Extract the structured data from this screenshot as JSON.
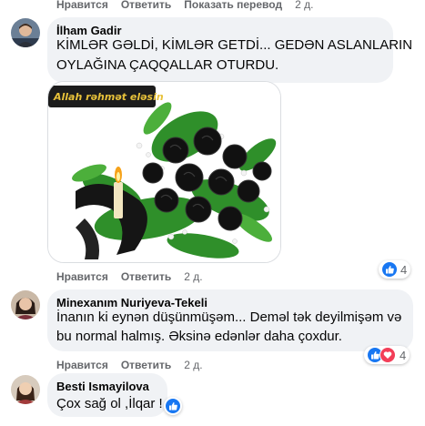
{
  "top_actions": {
    "like": "Нравится",
    "reply": "Ответить",
    "translate": "Показать перевод",
    "time": "2 д."
  },
  "comments": [
    {
      "author": "İlham Gadir",
      "lines": [
        "KİMLƏR GƏLDİ, KİMLƏR GETDİ... GEDƏN ASLANLARIN",
        "OYLAĞINA ÇAQQALLAR OTURDU."
      ],
      "image_caption": "Allah rəhmət eləsin",
      "actions": {
        "like": "Нравится",
        "reply": "Ответить",
        "time": "2 д."
      },
      "reactions": {
        "count": "4"
      }
    },
    {
      "author": "Minexanım Nuriyeva-Tekeli",
      "lines": [
        "İnanın ki eynən düşünmüşəm... Deməl tək deyilmişəm və",
        "bu normal halmış. Əksinə edənlər daha çoxdur."
      ],
      "actions": {
        "like": "Нравится",
        "reply": "Ответить",
        "time": "2 д."
      },
      "reactions": {
        "count": "4"
      }
    },
    {
      "author": "Besti Ismayilova",
      "lines": [
        "Çox sağ ol ,İlqar !"
      ]
    }
  ],
  "colors": {
    "like": "#1877f2",
    "love": "#f33e58",
    "bubble": "#f0f2f5",
    "meta": "#65676b"
  }
}
